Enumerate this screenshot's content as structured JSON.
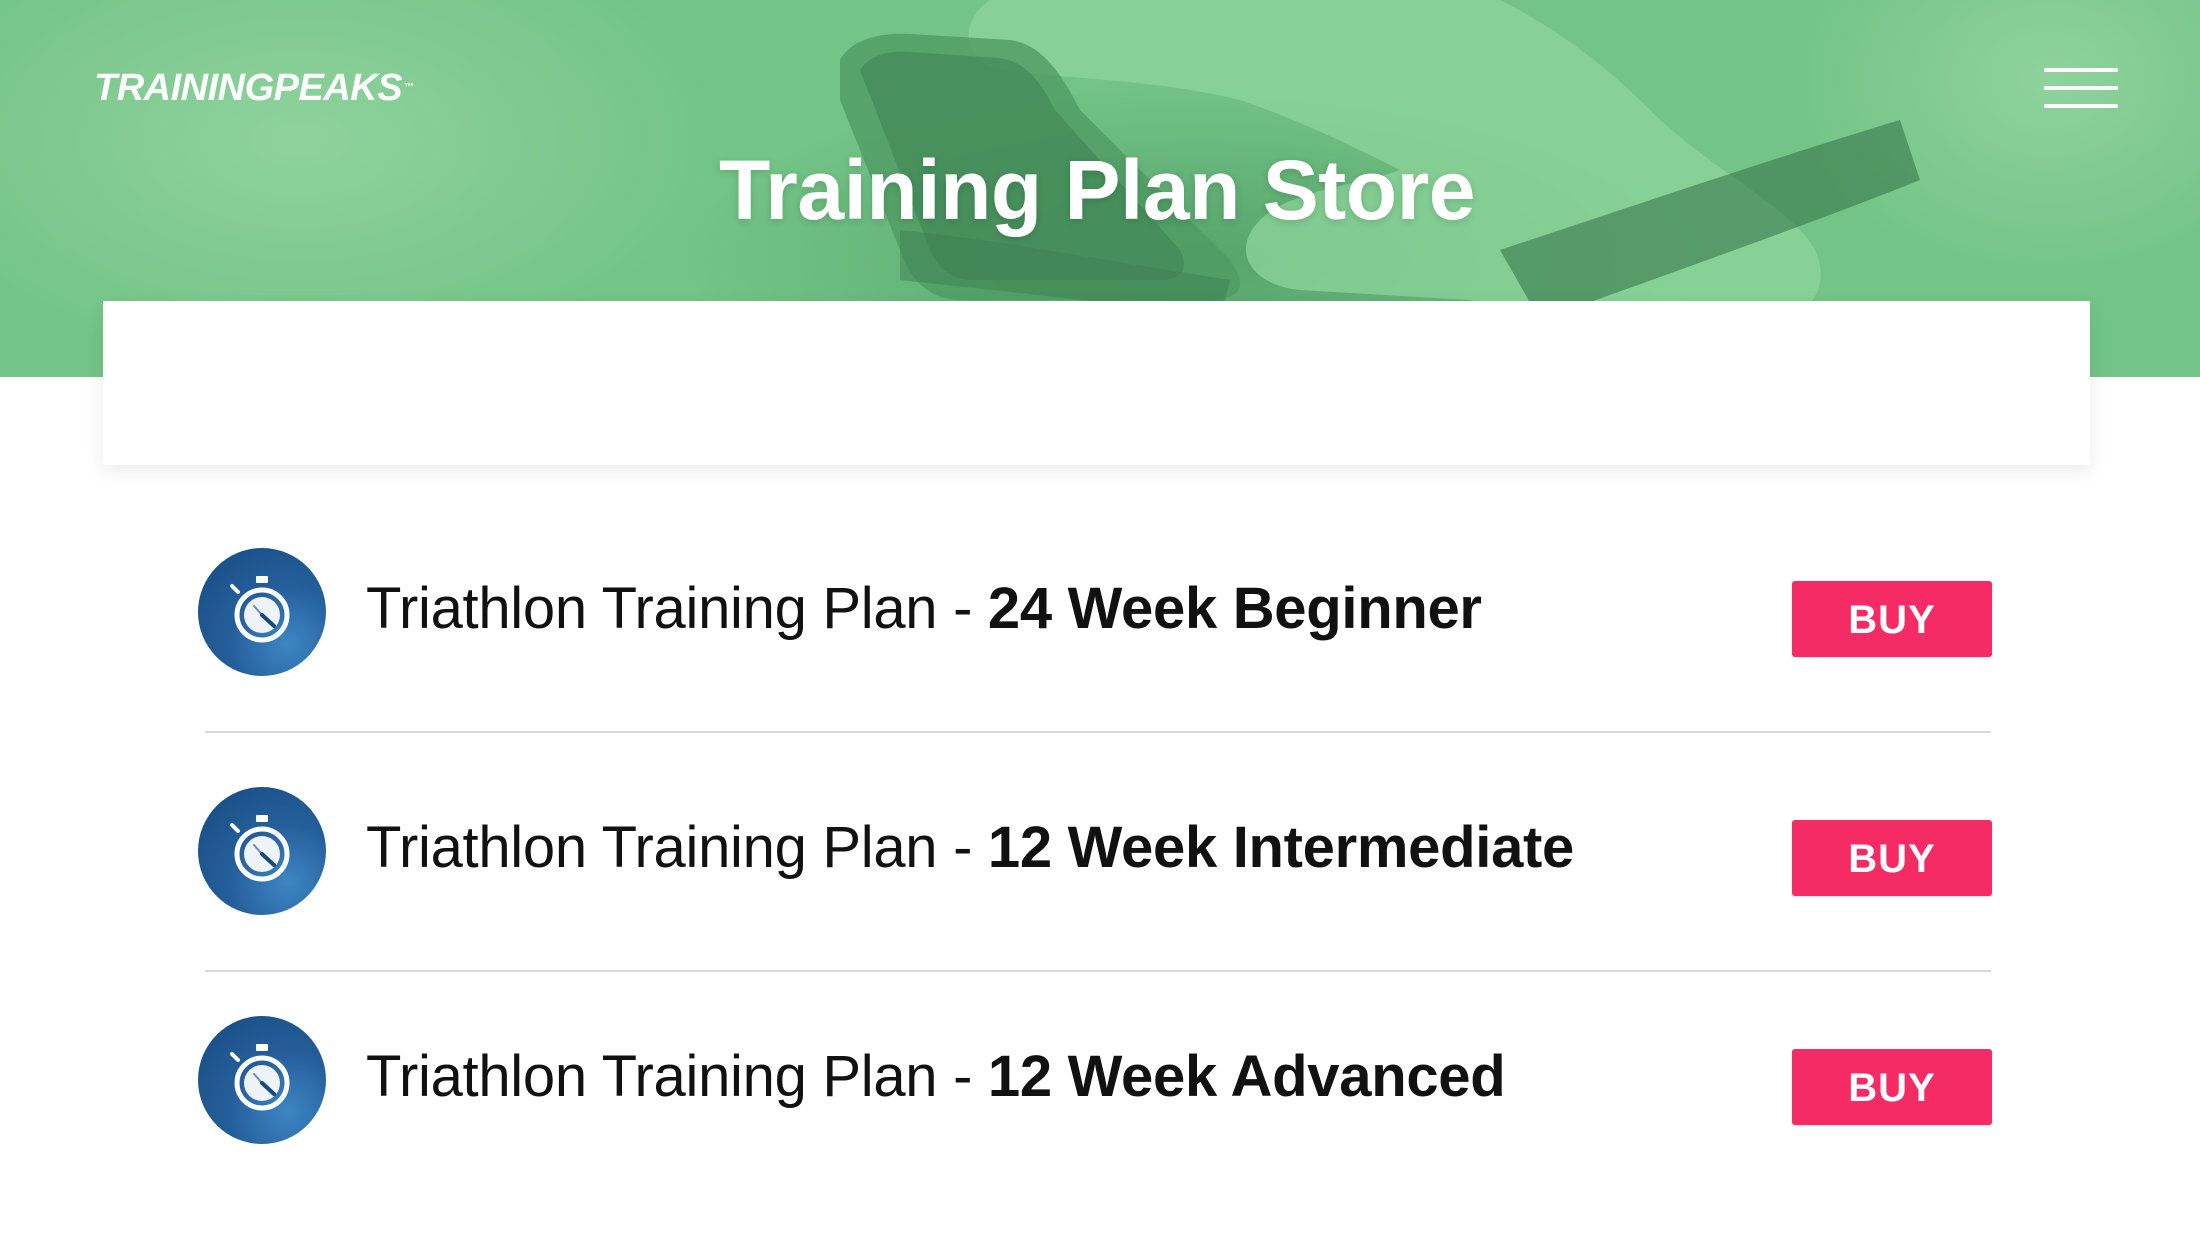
{
  "header": {
    "logo": "TRAININGPEAKS",
    "logo_tm": "™",
    "title": "Training Plan Store",
    "menu_icon": "hamburger-menu-icon"
  },
  "plans": [
    {
      "prefix": "Triathlon Training Plan - ",
      "name": "24 Week Beginner",
      "icon": "stopwatch-icon",
      "buy_label": "BUY"
    },
    {
      "prefix": "Triathlon Training Plan - ",
      "name": "12 Week Intermediate",
      "icon": "stopwatch-icon",
      "buy_label": "BUY"
    },
    {
      "prefix": "Triathlon Training Plan - ",
      "name": "12 Week Advanced",
      "icon": "stopwatch-icon",
      "buy_label": "BUY"
    }
  ],
  "colors": {
    "hero_green": "#78c98a",
    "buy_button": "#f52b65",
    "icon_blue": "#245e9a",
    "divider": "#d6d9dc"
  }
}
